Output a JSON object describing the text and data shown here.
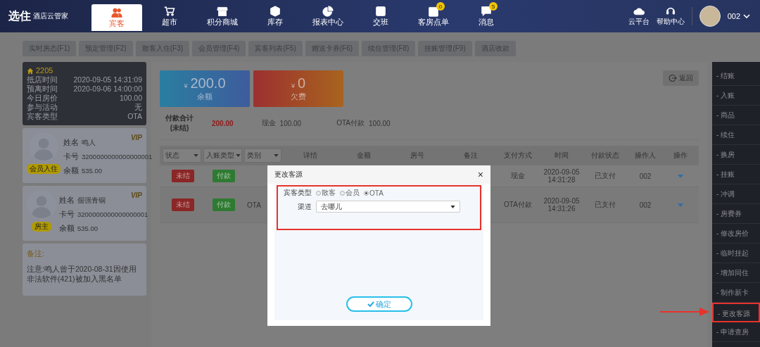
{
  "header": {
    "logo": "选住",
    "brand": "酒店云管家",
    "nav": [
      {
        "label": "宾客",
        "selected": true
      },
      {
        "label": "超市",
        "selected": false
      },
      {
        "label": "积分商城",
        "selected": false
      },
      {
        "label": "库存",
        "selected": false
      },
      {
        "label": "报表中心",
        "selected": false
      },
      {
        "label": "交班",
        "selected": false
      },
      {
        "label": "客房点单",
        "selected": false,
        "badge": "0"
      },
      {
        "label": "消息",
        "selected": false,
        "badge": "5"
      }
    ],
    "tools": [
      "云平台",
      "帮助中心"
    ],
    "user": "002"
  },
  "tabs": [
    "实时房态(F1)",
    "预定管理(F2)",
    "散客入住(F3)",
    "会员管理(F4)",
    "宾客列表(F5)",
    "赠送卡券(F6)",
    "续住管理(F8)",
    "挂账管理(F9)",
    "酒店收款"
  ],
  "room": {
    "number": "2205",
    "fields": [
      {
        "label": "抵店时间",
        "value": "2020-09-05 14:31:09"
      },
      {
        "label": "预离时间",
        "value": "2020-09-06 14:00:00"
      },
      {
        "label": "今日房价",
        "value": "100.00"
      },
      {
        "label": "参与活动",
        "value": "无"
      },
      {
        "label": "宾客类型",
        "value": "OTA"
      }
    ]
  },
  "guests": [
    {
      "badge": "会员入住",
      "vip": "VIP",
      "fields": [
        {
          "label": "姓名",
          "value": "鸣人"
        },
        {
          "label": "卡号",
          "value": "3200000000000000001"
        },
        {
          "label": "余额",
          "value": "535.00"
        }
      ]
    },
    {
      "badge": "房主",
      "vip": "VIP",
      "fields": [
        {
          "label": "姓名",
          "value": "倔强青铜"
        },
        {
          "label": "卡号",
          "value": "3200000000000000001"
        },
        {
          "label": "余额",
          "value": "535.00"
        }
      ]
    }
  ],
  "remark": {
    "label": "备注:",
    "text": "注意:鸣人曾于2020-08-31因使用非法软件(421)被加入黑名单"
  },
  "balances": [
    {
      "kind": "balance",
      "currency": "¥",
      "amount": "200.0",
      "label": "余额"
    },
    {
      "kind": "debt",
      "currency": "¥",
      "amount": "0",
      "label": "欠费"
    }
  ],
  "back_button": "返回",
  "summary": {
    "total_label": "付款合计",
    "total_sub": "(未结)",
    "total": "200.00",
    "items": [
      {
        "label": "现金",
        "value": "100.00"
      },
      {
        "label": "OTA付款",
        "value": "100.00"
      }
    ]
  },
  "table": {
    "filters": [
      "状态",
      "入账类型",
      "类别"
    ],
    "columns": [
      "详情",
      "金额",
      "房号",
      "备注",
      "支付方式",
      "时间",
      "付款状态",
      "操作人",
      "操作"
    ],
    "rows": [
      {
        "status": "未结",
        "entry_type": "付款",
        "payment": "现金",
        "date": "2020-09-05",
        "clock": "14:31:28",
        "pay_status": "已支付",
        "operator": "002"
      },
      {
        "status": "未结",
        "entry_type": "付款",
        "category": "OTA",
        "payment": "OTA付款",
        "date": "2020-09-05",
        "clock": "14:31:26",
        "pay_status": "已支付",
        "operator": "002"
      }
    ]
  },
  "actions": [
    {
      "label": "- 结账",
      "selected": false
    },
    {
      "label": "- 入账",
      "selected": false
    },
    {
      "label": "- 商品",
      "selected": false
    },
    {
      "label": "- 续住",
      "selected": false
    },
    {
      "label": "- 换房",
      "selected": false
    },
    {
      "label": "- 挂账",
      "selected": false
    },
    {
      "label": "- 冲调",
      "selected": false
    },
    {
      "label": "- 房费券",
      "selected": false
    },
    {
      "label": "- 修改房价",
      "selected": false
    },
    {
      "label": "- 临时挂起",
      "selected": false
    },
    {
      "label": "- 增加同住",
      "selected": false
    },
    {
      "label": "- 制作新卡",
      "selected": false
    },
    {
      "label": "- 更改客源",
      "selected": true
    },
    {
      "label": "- 申请查房",
      "selected": false
    }
  ],
  "dialog": {
    "title": "更改客源",
    "close": "×",
    "type_label": "宾客类型",
    "options": [
      {
        "label": "散客",
        "selected": false
      },
      {
        "label": "会员",
        "selected": false
      },
      {
        "label": "OTA",
        "selected": true
      }
    ],
    "channel_label": "渠道",
    "channel": "去哪儿",
    "confirm": "确定"
  }
}
